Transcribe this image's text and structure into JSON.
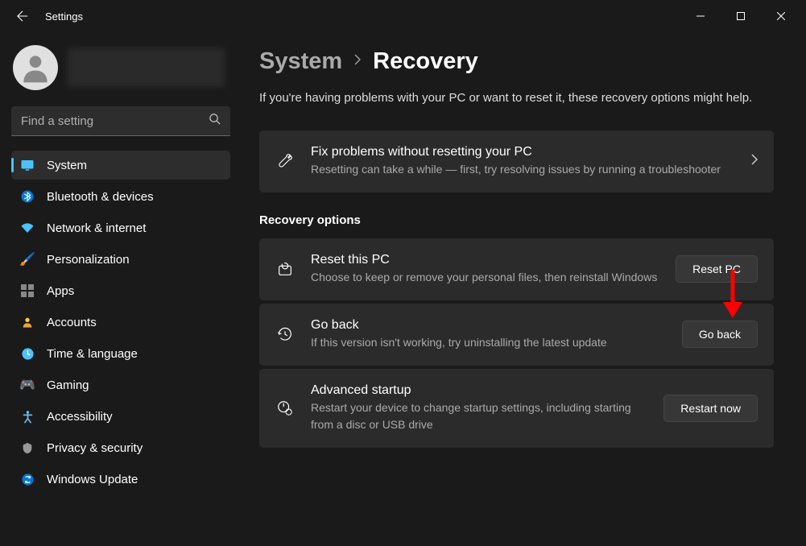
{
  "window": {
    "title": "Settings"
  },
  "search": {
    "placeholder": "Find a setting"
  },
  "sidebar": {
    "items": [
      {
        "label": "System",
        "icon": "monitor"
      },
      {
        "label": "Bluetooth & devices",
        "icon": "bluetooth"
      },
      {
        "label": "Network & internet",
        "icon": "wifi"
      },
      {
        "label": "Personalization",
        "icon": "paint"
      },
      {
        "label": "Apps",
        "icon": "grid"
      },
      {
        "label": "Accounts",
        "icon": "person"
      },
      {
        "label": "Time & language",
        "icon": "clock"
      },
      {
        "label": "Gaming",
        "icon": "gamepad"
      },
      {
        "label": "Accessibility",
        "icon": "accessibility"
      },
      {
        "label": "Privacy & security",
        "icon": "shield"
      },
      {
        "label": "Windows Update",
        "icon": "sync"
      }
    ]
  },
  "breadcrumb": {
    "parent": "System",
    "current": "Recovery"
  },
  "page": {
    "description": "If you're having problems with your PC or want to reset it, these recovery options might help."
  },
  "cards": {
    "troubleshooter": {
      "title": "Fix problems without resetting your PC",
      "desc": "Resetting can take a while — first, try resolving issues by running a troubleshooter"
    }
  },
  "section": {
    "title": "Recovery options"
  },
  "options": {
    "reset": {
      "title": "Reset this PC",
      "desc": "Choose to keep or remove your personal files, then reinstall Windows",
      "button": "Reset PC"
    },
    "goback": {
      "title": "Go back",
      "desc": "If this version isn't working, try uninstalling the latest update",
      "button": "Go back"
    },
    "advanced": {
      "title": "Advanced startup",
      "desc": "Restart your device to change startup settings, including starting from a disc or USB drive",
      "button": "Restart now"
    }
  }
}
